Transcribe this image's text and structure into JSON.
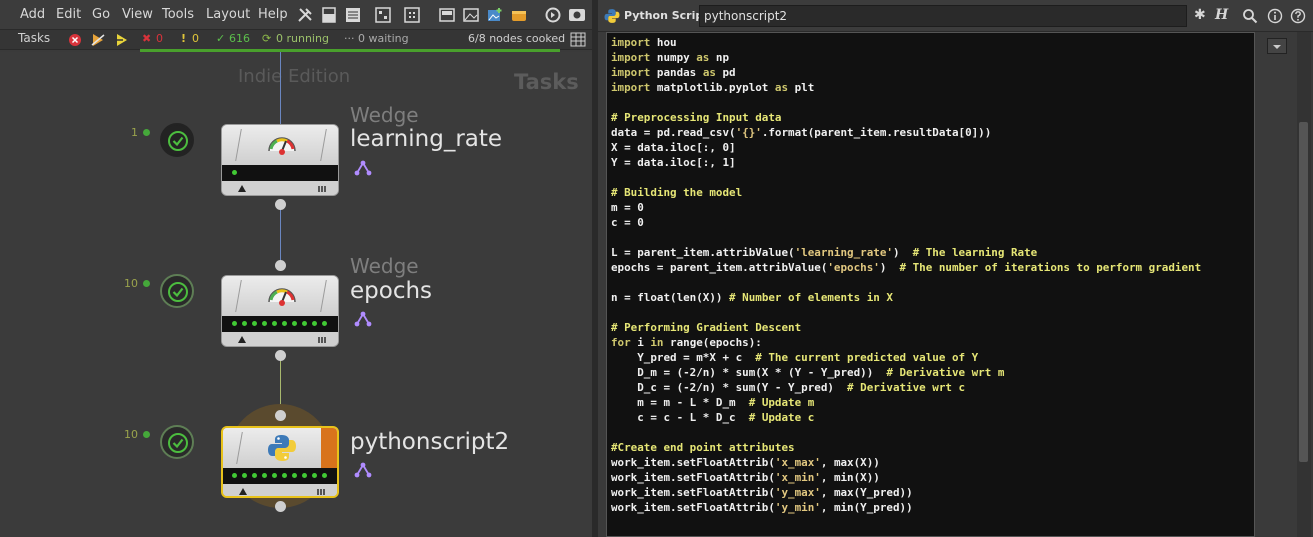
{
  "menubar": {
    "items": [
      "Add",
      "Edit",
      "Go",
      "View",
      "Tools",
      "Layout",
      "Help"
    ]
  },
  "taskbar": {
    "label": "Tasks",
    "failed": "0",
    "warnings": "0",
    "cooked": "616",
    "running": "0 running",
    "waiting": "0 waiting",
    "nodes_cooked": "6/8 nodes cooked"
  },
  "network": {
    "edition_watermark": "Indie Edition",
    "context_watermark": "Tasks",
    "nodes": [
      {
        "type": "Wedge",
        "name": "learning_rate",
        "count": "1",
        "work_items": 1
      },
      {
        "type": "Wedge",
        "name": "epochs",
        "count": "10",
        "work_items": 10
      },
      {
        "type": "",
        "name": "pythonscript2",
        "count": "10",
        "work_items": 10,
        "selected": true
      }
    ]
  },
  "params": {
    "node_type": "Python Script",
    "node_name": "pythonscript2"
  },
  "code": [
    "import hou",
    "import numpy as np",
    "import pandas as pd",
    "import matplotlib.pyplot as plt",
    "",
    "# Preprocessing Input data",
    "data = pd.read_csv('{}'.format(parent_item.resultData[0]))",
    "X = data.iloc[:, 0]",
    "Y = data.iloc[:, 1]",
    "",
    "# Building the model",
    "m = 0",
    "c = 0",
    "",
    "L = parent_item.attribValue('learning_rate')  # The learning Rate",
    "epochs = parent_item.attribValue('epochs')  # The number of iterations to perform gradient",
    "",
    "n = float(len(X)) # Number of elements in X",
    "",
    "# Performing Gradient Descent",
    "for i in range(epochs):",
    "    Y_pred = m*X + c  # The current predicted value of Y",
    "    D_m = (-2/n) * sum(X * (Y - Y_pred))  # Derivative wrt m",
    "    D_c = (-2/n) * sum(Y - Y_pred)  # Derivative wrt c",
    "    m = m - L * D_m  # Update m",
    "    c = c - L * D_c  # Update c",
    "",
    "#Create end point attributes",
    "work_item.setFloatAttrib('x_max', max(X))",
    "work_item.setFloatAttrib('x_min', min(X))",
    "work_item.setFloatAttrib('y_max', max(Y_pred))",
    "work_item.setFloatAttrib('y_min', min(Y_pred))"
  ],
  "colors": {
    "accent_green": "#45a83a",
    "selected_yellow": "#e8c21a",
    "node_orange": "#d8731c",
    "split_purple": "#a77bff"
  }
}
